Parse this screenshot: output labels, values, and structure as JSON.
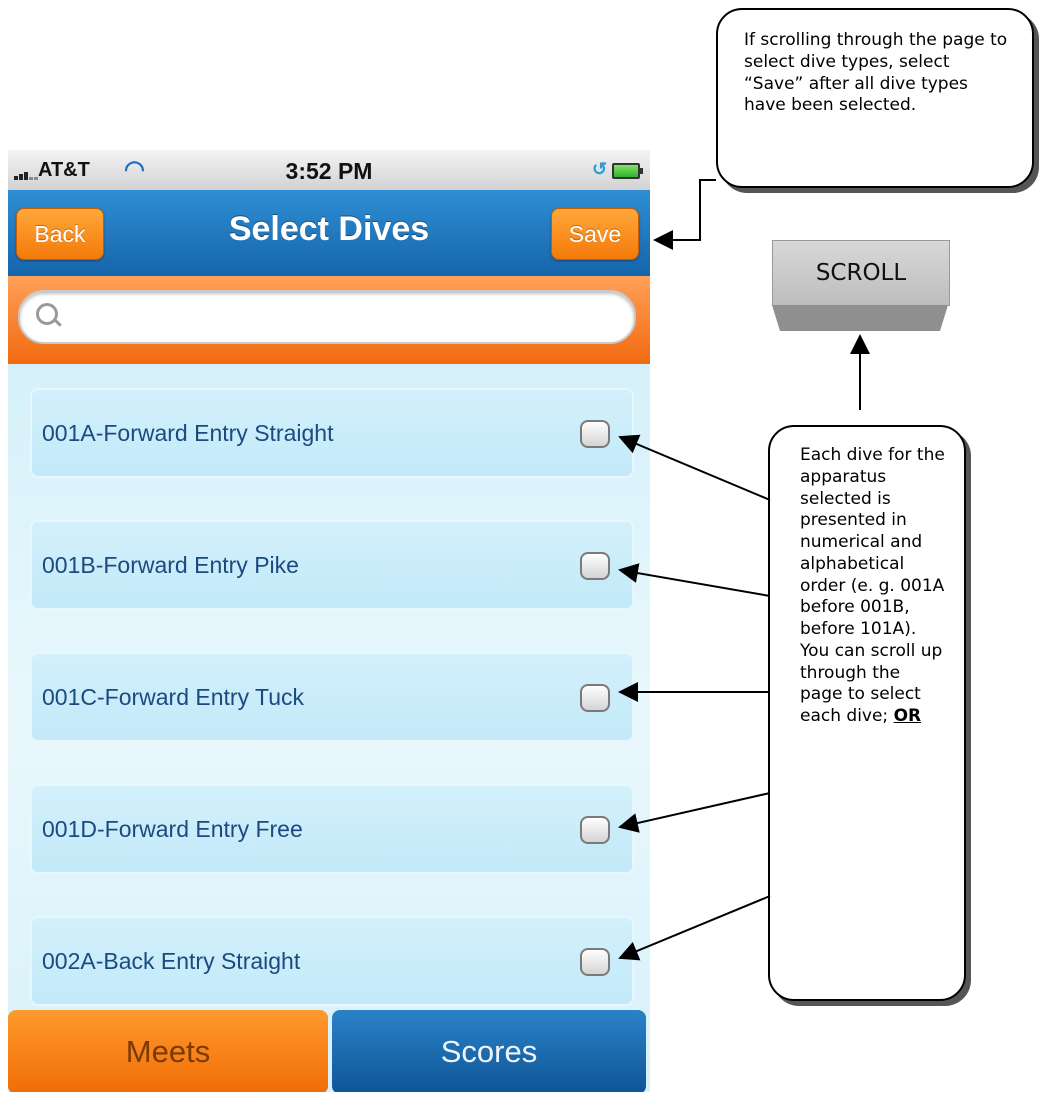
{
  "status": {
    "carrier": "AT&T",
    "time": "3:52 PM"
  },
  "nav": {
    "back_label": "Back",
    "title": "Select Dives",
    "save_label": "Save"
  },
  "search": {
    "placeholder": "",
    "value": ""
  },
  "dives": [
    {
      "label": "001A-Forward Entry Straight",
      "checked": false
    },
    {
      "label": "001B-Forward Entry Pike",
      "checked": false
    },
    {
      "label": "001C-Forward Entry Tuck",
      "checked": false
    },
    {
      "label": "001D-Forward Entry Free",
      "checked": false
    },
    {
      "label": "002A-Back Entry Straight",
      "checked": false
    }
  ],
  "tabs": {
    "meets": "Meets",
    "scores": "Scores"
  },
  "annotations": {
    "save_note": "If scrolling through the page to select dive types, select “Save” after all dive types have been selected.",
    "scroll_label": "SCROLL",
    "scroll_note_text": "Each dive for the apparatus selected is presented in numerical and alphabetical order (e. g. 001A before 001B, before 101A).  You can scroll up through the page to select each dive; ",
    "scroll_note_emphasis": "OR"
  },
  "colors": {
    "nav_blue": "#1565aa",
    "accent_orange": "#f37a0a",
    "row_text": "#1b4a80"
  }
}
